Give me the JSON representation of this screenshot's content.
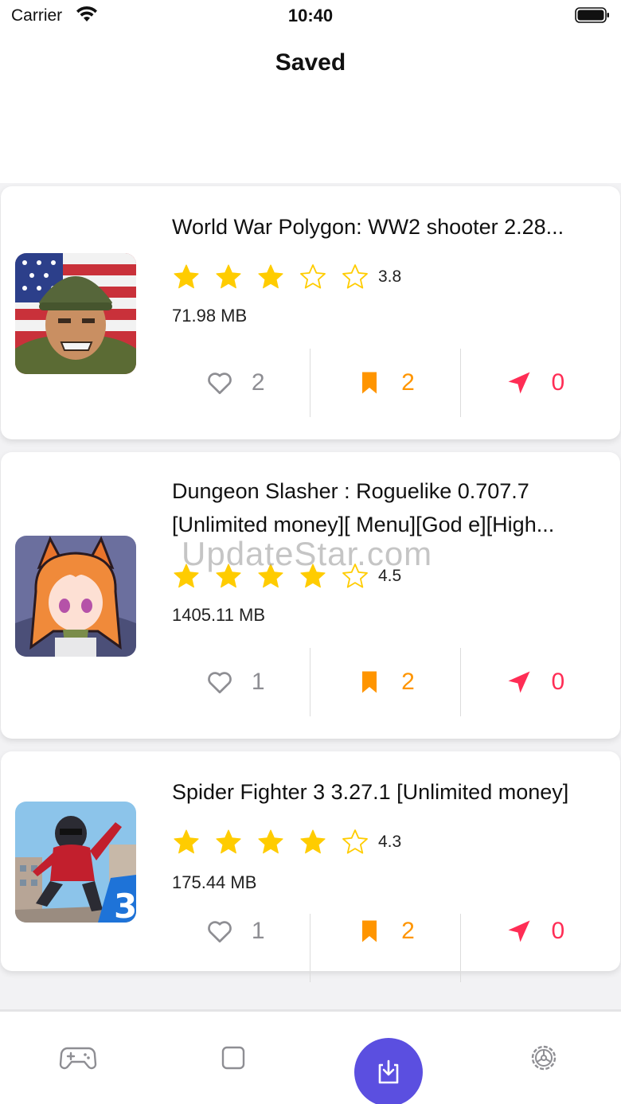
{
  "status_bar": {
    "carrier": "Carrier",
    "time": "10:40"
  },
  "nav": {
    "title": "Saved"
  },
  "watermark": "UpdateStar.com",
  "colors": {
    "accent": "#5b4fe0",
    "star": "#ffcc00",
    "save": "#ff9500",
    "share": "#ff2d55",
    "like": "#8e8e93"
  },
  "games": [
    {
      "title_lines": [
        "World War Polygon: WW2 shooter 2.28..."
      ],
      "stars_filled": 3,
      "rating": "3.8",
      "size": "71.98 MB",
      "likes": "2",
      "saves": "2",
      "shares": "0"
    },
    {
      "title_lines": [
        "Dungeon Slasher : Roguelike 0.707.7",
        "[Unlimited money][ Menu][God e][High..."
      ],
      "stars_filled": 4,
      "rating": "4.5",
      "size": "1405.11 MB",
      "likes": "1",
      "saves": "2",
      "shares": "0"
    },
    {
      "title_lines": [
        "Spider Fighter 3 3.27.1 [Unlimited money]"
      ],
      "stars_filled": 4,
      "rating": "4.3",
      "size": "175.44 MB",
      "likes": "1",
      "saves": "2",
      "shares": "0"
    }
  ],
  "tabs": [
    {
      "icon": "gamepad-icon",
      "active": false
    },
    {
      "icon": "square-icon",
      "active": false
    },
    {
      "icon": "download-tray-icon",
      "active": true
    },
    {
      "icon": "gear-icon",
      "active": false
    }
  ]
}
